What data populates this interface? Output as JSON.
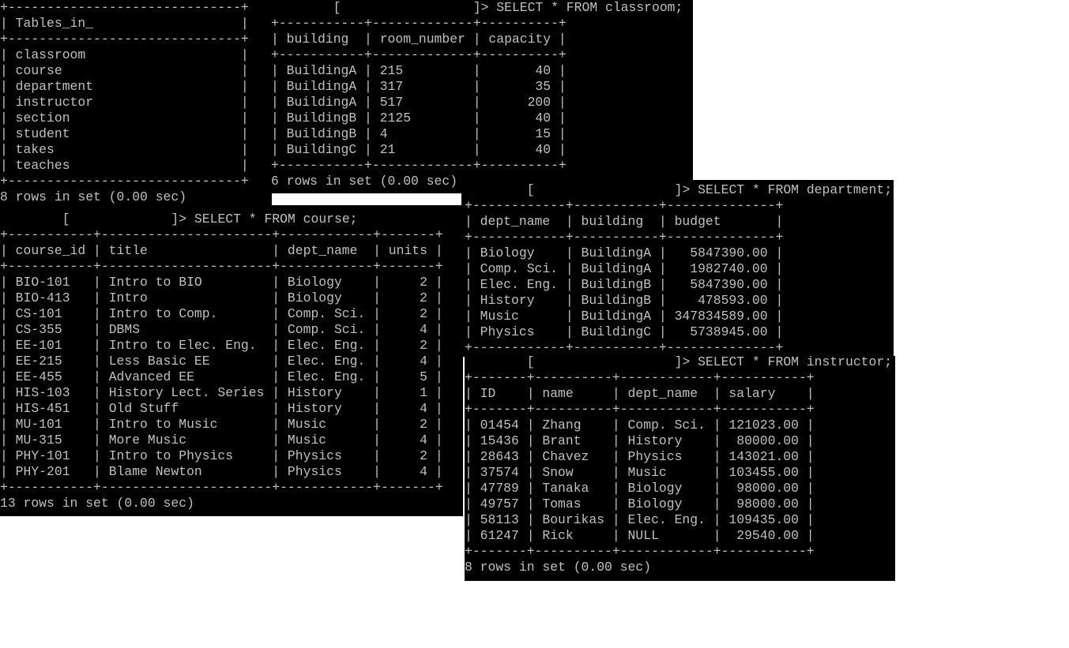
{
  "theme": {
    "background": "#000000",
    "text": "#c0c0c0",
    "page": "#ffffff"
  },
  "panels": {
    "tables": {
      "header": "Tables_in_",
      "rows": [
        "classroom",
        "course",
        "department",
        "instructor",
        "section",
        "student",
        "takes",
        "teaches"
      ],
      "status": "8 rows in set (0.00 sec)"
    },
    "classroom": {
      "prompt_open": "[",
      "prompt_close": "]>",
      "query": "SELECT * FROM classroom;",
      "columns": [
        "building",
        "room_number",
        "capacity"
      ],
      "rows": [
        [
          "BuildingA",
          "215",
          "40"
        ],
        [
          "BuildingA",
          "317",
          "35"
        ],
        [
          "BuildingA",
          "517",
          "200"
        ],
        [
          "BuildingB",
          "2125",
          "40"
        ],
        [
          "BuildingB",
          "4",
          "15"
        ],
        [
          "BuildingC",
          "21",
          "40"
        ]
      ],
      "status": "6 rows in set (0.00 sec)"
    },
    "course": {
      "prompt_open": "[",
      "prompt_close": "]>",
      "query": "SELECT * FROM course;",
      "columns": [
        "course_id",
        "title",
        "dept_name",
        "units"
      ],
      "rows": [
        [
          "BIO-101",
          "Intro to BIO",
          "Biology",
          "2"
        ],
        [
          "BIO-413",
          "Intro",
          "Biology",
          "2"
        ],
        [
          "CS-101",
          "Intro to Comp.",
          "Comp. Sci.",
          "2"
        ],
        [
          "CS-355",
          "DBMS",
          "Comp. Sci.",
          "4"
        ],
        [
          "EE-101",
          "Intro to Elec. Eng.",
          "Elec. Eng.",
          "2"
        ],
        [
          "EE-215",
          "Less Basic EE",
          "Elec. Eng.",
          "4"
        ],
        [
          "EE-455",
          "Advanced EE",
          "Elec. Eng.",
          "5"
        ],
        [
          "HIS-103",
          "History Lect. Series",
          "History",
          "1"
        ],
        [
          "HIS-451",
          "Old Stuff",
          "History",
          "4"
        ],
        [
          "MU-101",
          "Intro to Music",
          "Music",
          "2"
        ],
        [
          "MU-315",
          "More Music",
          "Music",
          "4"
        ],
        [
          "PHY-101",
          "Intro to Physics",
          "Physics",
          "2"
        ],
        [
          "PHY-201",
          "Blame Newton",
          "Physics",
          "4"
        ]
      ],
      "status": "13 rows in set (0.00 sec)"
    },
    "department": {
      "prompt_open": "[",
      "prompt_close": "]>",
      "query": "SELECT * FROM department;",
      "columns": [
        "dept_name",
        "building",
        "budget"
      ],
      "rows": [
        [
          "Biology",
          "BuildingA",
          "5847390.00"
        ],
        [
          "Comp. Sci.",
          "BuildingA",
          "1982740.00"
        ],
        [
          "Elec. Eng.",
          "BuildingB",
          "5847390.00"
        ],
        [
          "History",
          "BuildingB",
          "478593.00"
        ],
        [
          "Music",
          "BuildingA",
          "347834589.00"
        ],
        [
          "Physics",
          "BuildingC",
          "5738945.00"
        ]
      ]
    },
    "instructor": {
      "prompt_open": "[",
      "prompt_close": "]>",
      "query": "SELECT * FROM instructor;",
      "columns": [
        "ID",
        "name",
        "dept_name",
        "salary"
      ],
      "rows": [
        [
          "01454",
          "Zhang",
          "Comp. Sci.",
          "121023.00"
        ],
        [
          "15436",
          "Brant",
          "History",
          "80000.00"
        ],
        [
          "28643",
          "Chavez",
          "Physics",
          "143021.00"
        ],
        [
          "37574",
          "Snow",
          "Music",
          "103455.00"
        ],
        [
          "47789",
          "Tanaka",
          "Biology",
          "98000.00"
        ],
        [
          "49757",
          "Tomas",
          "Biology",
          "98000.00"
        ],
        [
          "58113",
          "Bourikas",
          "Elec. Eng.",
          "109435.00"
        ],
        [
          "61247",
          "Rick",
          "NULL",
          "29540.00"
        ]
      ],
      "status": "8 rows in set (0.00 sec)"
    }
  }
}
